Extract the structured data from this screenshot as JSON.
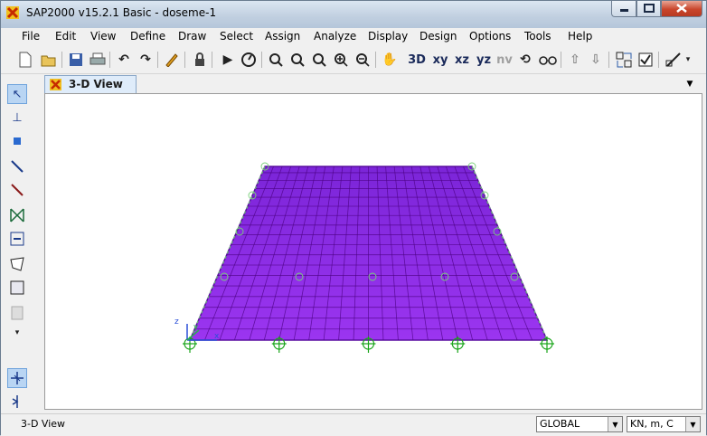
{
  "window": {
    "title": "SAP2000 v15.2.1 Basic  - doseme-1"
  },
  "menu": [
    "File",
    "Edit",
    "View",
    "Define",
    "Draw",
    "Select",
    "Assign",
    "Analyze",
    "Display",
    "Design",
    "Options",
    "Tools",
    "Help"
  ],
  "toolbar": {
    "view_labels": {
      "3d": "3D",
      "xy": "xy",
      "xz": "xz",
      "yz": "yz",
      "nv": "nv"
    }
  },
  "tab": {
    "label": "3-D View"
  },
  "axes": {
    "z": "z",
    "y": "y",
    "x": "x"
  },
  "status": {
    "text": "3-D View",
    "coord_system": "GLOBAL",
    "units": "KN, m, C"
  },
  "colors": {
    "slab_fill": "#8a2be2",
    "mesh_line": "#4b0082",
    "support": "#18a418",
    "accent": "#c62a00"
  }
}
